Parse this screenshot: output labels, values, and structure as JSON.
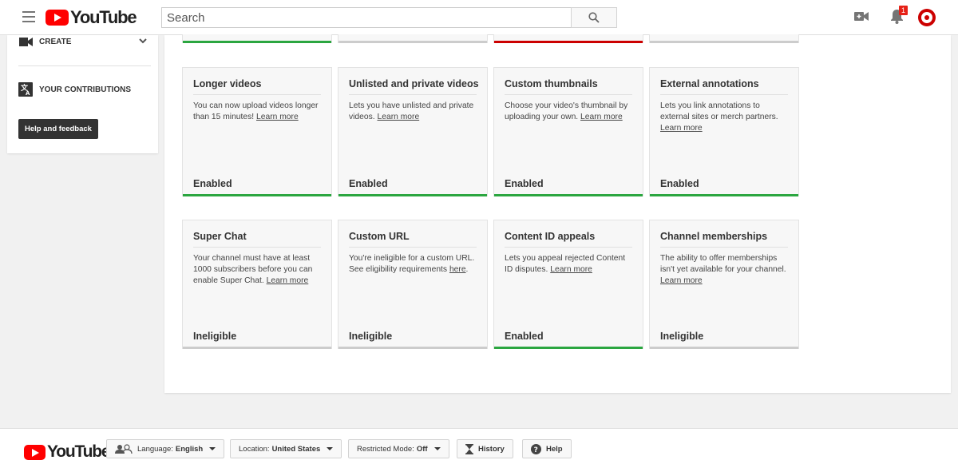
{
  "header": {
    "logo_text": "YouTube",
    "search_placeholder": "Search",
    "notification_count": "1"
  },
  "sidebar": {
    "create_label": "CREATE",
    "contributions_label": "YOUR CONTRIBUTIONS",
    "help_label": "Help and feedback"
  },
  "top_cards": [
    {
      "status_color": "green"
    },
    {
      "status_color": "none"
    },
    {
      "status_color": "red"
    },
    {
      "status_color": "none"
    }
  ],
  "features": [
    {
      "title": "Longer videos",
      "desc": "You can now upload videos longer than 15 minutes!",
      "link": "Learn more",
      "status": "Enabled",
      "status_color": "green"
    },
    {
      "title": "Unlisted and private videos",
      "desc": "Lets you have unlisted and private videos.",
      "link": "Learn more",
      "status": "Enabled",
      "status_color": "green"
    },
    {
      "title": "Custom thumbnails",
      "desc": "Choose your video's thumbnail by uploading your own.",
      "link": "Learn more",
      "status": "Enabled",
      "status_color": "green"
    },
    {
      "title": "External annotations",
      "desc": "Lets you link annotations to external sites or merch partners.",
      "link": "Learn more",
      "status": "Enabled",
      "status_color": "green"
    },
    {
      "title": "Super Chat",
      "desc": "Your channel must have at least 1000 subscribers before you can enable Super Chat.",
      "link": "Learn more",
      "status": "Ineligible",
      "status_color": "none"
    },
    {
      "title": "Custom URL",
      "desc": "You're ineligible for a custom URL. See eligibility requirements",
      "link": "here",
      "link_suffix": ".",
      "status": "Ineligible",
      "status_color": "none"
    },
    {
      "title": "Content ID appeals",
      "desc": "Lets you appeal rejected Content ID disputes.",
      "link": "Learn more",
      "status": "Enabled",
      "status_color": "green"
    },
    {
      "title": "Channel memberships",
      "desc": "The ability to offer memberships isn't yet available for your channel.",
      "link": "Learn more",
      "status": "Ineligible",
      "status_color": "none"
    }
  ],
  "footer": {
    "logo_text": "YouTube",
    "language_label": "Language:",
    "language_value": "English",
    "location_label": "Location:",
    "location_value": "United States",
    "restricted_label": "Restricted Mode:",
    "restricted_value": "Off",
    "history_label": "History",
    "help_label": "Help"
  },
  "colors": {
    "green": "#2ba640",
    "red": "#cc0000",
    "brand": "#ff0000"
  }
}
